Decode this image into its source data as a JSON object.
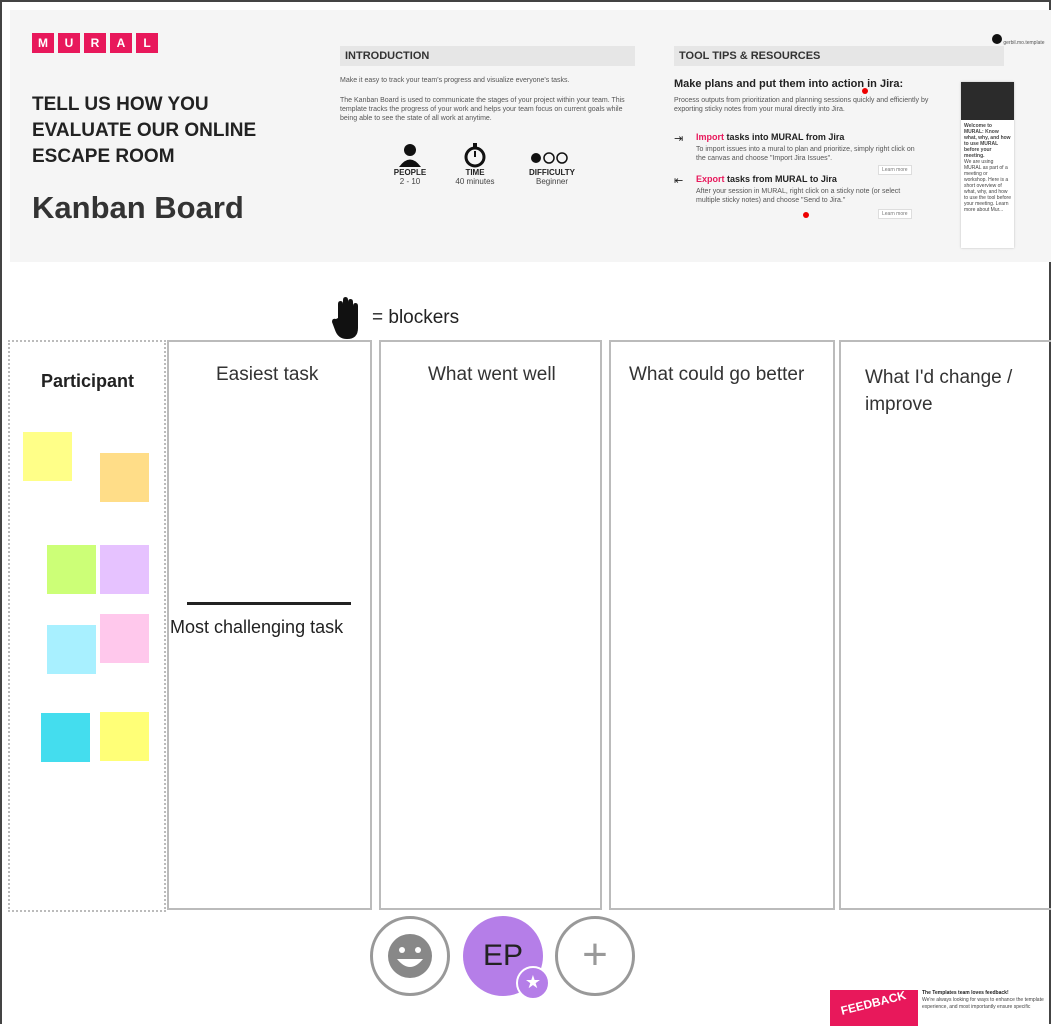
{
  "header": {
    "logo_letters": [
      "M",
      "U",
      "R",
      "A",
      "L"
    ],
    "subtitle": "TELL US HOW YOU EVALUATE OUR ONLINE ESCAPE ROOM",
    "title": "Kanban Board",
    "user_chip": "gerbil.mo.template"
  },
  "introduction": {
    "heading": "INTRODUCTION",
    "line1": "Make it easy to track your team's progress and visualize everyone's tasks.",
    "line2": "The Kanban Board is used to communicate the stages of your project within your team. This template tracks the progress of your work and helps your team focus on current goals while being able to see the state of all work at anytime.",
    "stats": [
      {
        "icon": "person-icon",
        "label": "PEOPLE",
        "value": "2 - 10"
      },
      {
        "icon": "stopwatch-icon",
        "label": "TIME",
        "value": "40 minutes"
      },
      {
        "icon": "difficulty-dots-icon",
        "label": "DIFFICULTY",
        "value": "Beginner"
      }
    ]
  },
  "tool_tips": {
    "heading": "TOOL TIPS & RESOURCES",
    "jira_heading": "Make plans and put them into action in Jira:",
    "jira_desc": "Process outputs from prioritization and planning sessions quickly and efficiently by exporting sticky notes from your mural directly into Jira.",
    "import_word": "Import",
    "import_rest": " tasks into MURAL from Jira",
    "import_desc": "To import issues into a mural to plan and prioritize, simply right click on the canvas and choose \"Import Jira Issues\".",
    "export_word": "Export",
    "export_rest": " tasks from MURAL to Jira",
    "export_desc": "After your session in MURAL, right click on a sticky note (or select multiple sticky notes) and choose \"Send to Jira.\"",
    "learn_more": "Learn more",
    "card_title": "Welcome to MURAL: Know what, why, and how to use MURAL before your meeting.",
    "card_body": "We are using MURAL as part of a meeting or workshop. Here is a short overview of what, why, and how to use the tool before your meeting. Learn more about Mur..."
  },
  "legend": {
    "text": "= blockers"
  },
  "columns": {
    "participant": "Participant",
    "easiest": "Easiest task",
    "challenging": "Most challenging  task",
    "went_well": "What went well",
    "go_better": "What could go better",
    "change": "What I'd change / improve"
  },
  "sticky_colors": [
    "#ffff88",
    "#ffdd88",
    "#ccff77",
    "#e6c2ff",
    "#a8f0ff",
    "#ffc8ec",
    "#44ddee",
    "#ffff77"
  ],
  "toolbar": {
    "avatar_initials": "EP",
    "add_symbol": "+"
  },
  "feedback": {
    "badge": "FEEDBACK",
    "title": "The Templates team loves feedback!",
    "body": "We're always looking for ways to enhance the template experience, and most importantly ensure specific"
  }
}
